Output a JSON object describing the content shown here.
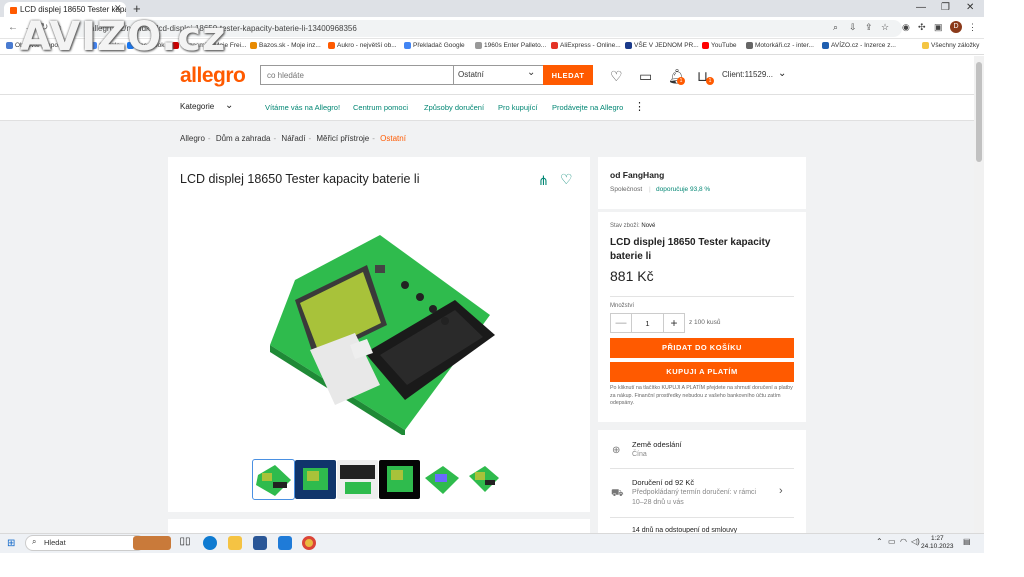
{
  "browser": {
    "tab_title": "LCD displej 18650 Tester kapaci",
    "address": "allegro.cz/nabidka/lcd-displej-18650-tester-kapacity-baterie-li-13400968356",
    "bookmarks": [
      "Obnovte prepo...",
      "Google",
      "Facebook",
      "Seznam",
      "Moje Frei...",
      "Bazos.sk - Moje inz...",
      "Aukro - největší ob...",
      "Překladač Google",
      "1960s Enter Palleto...",
      "AliExpress - Online...",
      "VŠE V JEDNOM PR...",
      "YouTube",
      "Motorkáři.cz - inter...",
      "AVÍZO.cz - Inzerce z...",
      "Všechny záložky"
    ],
    "profile_initial": "D",
    "watermark": "AVIZO.cz"
  },
  "header": {
    "logo": "allegro",
    "search_placeholder": "co hledáte",
    "category": "Ostatní",
    "search_button": "HLEDAT",
    "cart_badge": "1",
    "notif_badge": "1",
    "client": "Client:11529..."
  },
  "nav": {
    "categories": "Kategorie",
    "links": [
      "Vítáme vás na Allegro!",
      "Centrum pomoci",
      "Způsoby doručení",
      "Pro kupující",
      "Prodávejte na Allegro"
    ]
  },
  "breadcrumbs": [
    "Allegro",
    "Dům a zahrada",
    "Nářadí",
    "Měřicí přístroje",
    "Ostatní"
  ],
  "product": {
    "title": "LCD displej 18650 Tester kapacity baterie li",
    "thumb_count": 6
  },
  "seller": {
    "name": "od FangHang",
    "type": "Společnost",
    "recommend": "doporučuje 93,8 %"
  },
  "offer": {
    "condition_label": "Stav zboží:",
    "condition": "Nové",
    "title": "LCD displej 18650 Tester kapacity baterie li",
    "price": "881 Kč",
    "quantity_label": "Množství",
    "quantity": "1",
    "available": "z 100 kusů",
    "add_to_cart": "PŘIDAT DO KOŠÍKU",
    "buy_now": "KUPUJI A PLATÍM",
    "note": "Po kliknutí na tlačítko KUPUJI A PLATÍM přejdete na shrnutí doručení a platby za nákup. Finanční prostředky nebudou z vašeho bankovního účtu zatím odepsány."
  },
  "shipping": {
    "origin_label": "Země odeslání",
    "origin": "Čína",
    "delivery_label": "Doručení od 92 Kč",
    "delivery_detail": "Předpokládaný termín doručení: v rámci 10–28 dnů u vás",
    "returns": "14 dnů na odstoupení od smlouvy"
  },
  "taskbar": {
    "search": "Hledat",
    "time": "1:27",
    "date": "24.10.2023"
  }
}
